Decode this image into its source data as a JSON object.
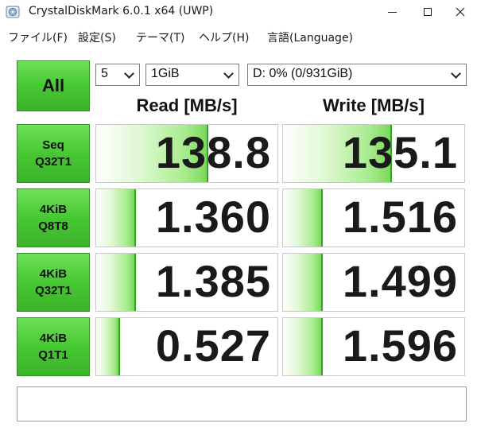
{
  "window": {
    "title": "CrystalDiskMark 6.0.1 x64 (UWP)",
    "accent": "#46c832"
  },
  "menu": [
    {
      "label": "ファイル(F)"
    },
    {
      "label": "設定(S)"
    },
    {
      "label": "テーマ(T)"
    },
    {
      "label": "ヘルプ(H)"
    },
    {
      "label": "言語(Language)"
    }
  ],
  "controls": {
    "all_label": "All",
    "count": "5",
    "size": "1GiB",
    "drive": "D: 0% (0/931GiB)"
  },
  "headers": {
    "read": "Read [MB/s]",
    "write": "Write [MB/s]"
  },
  "tests": [
    {
      "line1": "Seq",
      "line2": "Q32T1",
      "read": "138.8",
      "write": "135.1",
      "read_fill": 0.62,
      "write_fill": 0.6
    },
    {
      "line1": "4KiB",
      "line2": "Q8T8",
      "read": "1.360",
      "write": "1.516",
      "read_fill": 0.22,
      "write_fill": 0.22
    },
    {
      "line1": "4KiB",
      "line2": "Q32T1",
      "read": "1.385",
      "write": "1.499",
      "read_fill": 0.22,
      "write_fill": 0.22
    },
    {
      "line1": "4KiB",
      "line2": "Q1T1",
      "read": "0.527",
      "write": "1.596",
      "read_fill": 0.13,
      "write_fill": 0.22
    }
  ],
  "comment": ""
}
